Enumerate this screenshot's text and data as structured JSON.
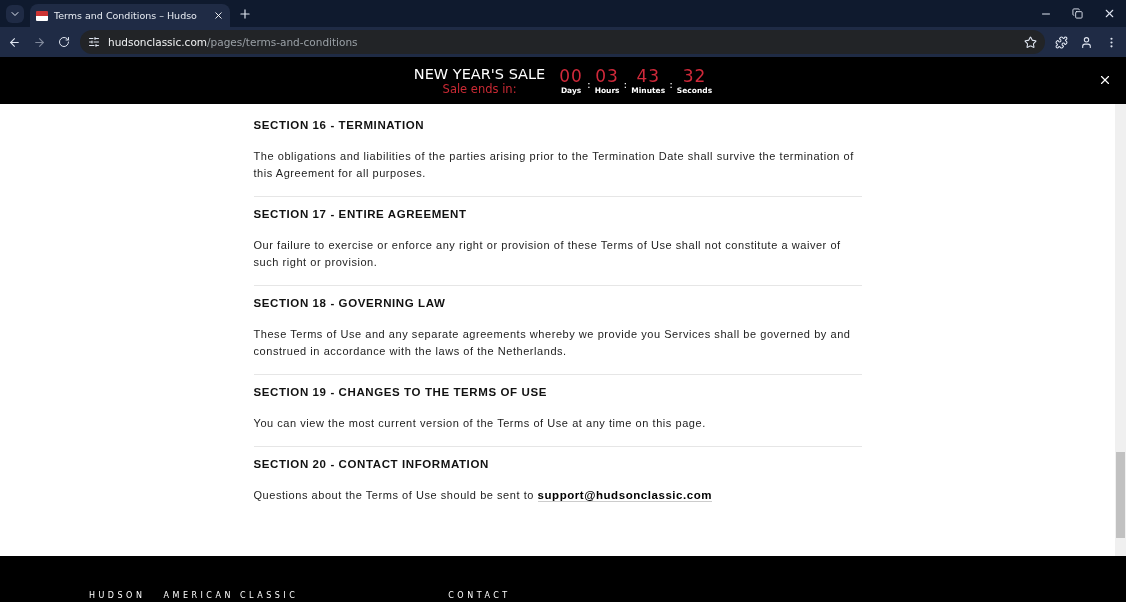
{
  "browser": {
    "tab_title": "Terms and Conditions – Hudso",
    "url_host": "hudsonclassic.com",
    "url_path": "/pages/terms-and-conditions"
  },
  "banner": {
    "title": "NEW YEAR'S SALE",
    "subtitle": "Sale ends in:",
    "separator": ":",
    "countdown": [
      {
        "value": "00",
        "unit": "Days"
      },
      {
        "value": "03",
        "unit": "Hours"
      },
      {
        "value": "43",
        "unit": "Minutes"
      },
      {
        "value": "32",
        "unit": "Seconds"
      }
    ]
  },
  "sections": [
    {
      "heading": "SECTION 16 - TERMINATION",
      "body": "The obligations and liabilities of the parties arising prior to the Termination Date shall survive the termination of this Agreement for all purposes."
    },
    {
      "heading": "SECTION 17 - ENTIRE AGREEMENT",
      "body": "Our failure to exercise or enforce any right or provision of these Terms of Use shall not constitute a waiver of such right or provision."
    },
    {
      "heading": "SECTION 18 - GOVERNING LAW",
      "body": "These Terms of Use and any separate agreements whereby we provide you Services shall be governed by and construed in accordance with the laws of the Netherlands."
    },
    {
      "heading": "SECTION 19 - CHANGES TO THE TERMS OF USE",
      "body": "You can view the most current version of the Terms of Use at any time on this page."
    },
    {
      "heading": "SECTION 20 - CONTACT INFORMATION",
      "body": "Questions about the Terms of Use should be sent to",
      "link": "support@hudsonclassic.com"
    }
  ],
  "footer": {
    "columns": [
      "HUDSON   AMERICAN CLASSIC",
      "CONTACT"
    ]
  }
}
